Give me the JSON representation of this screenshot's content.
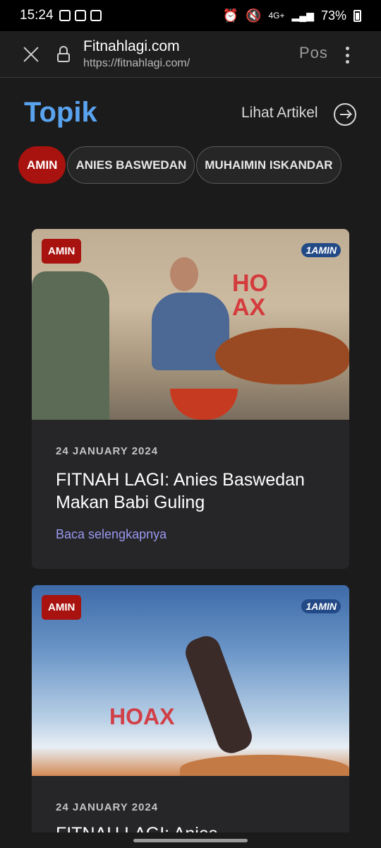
{
  "status_bar": {
    "time": "15:24",
    "network": "4G+",
    "battery": "73%"
  },
  "browser": {
    "site_title": "Fitnahlagi.com",
    "url": "https://fitnahlagi.com/",
    "partial_text": "Pos"
  },
  "topik": {
    "title": "Topik",
    "see_articles": "Lihat Artikel"
  },
  "tags": [
    {
      "label": "AMIN",
      "active": true
    },
    {
      "label": "ANIES BASWEDAN",
      "active": false
    },
    {
      "label": "MUHAIMIN ISKANDAR",
      "active": false
    }
  ],
  "articles": [
    {
      "badge": "AMIN",
      "logo": "1AMIN",
      "watermark": "HOAX",
      "date": "24 JANUARY 2024",
      "title": "FITNAH LAGI: Anies Baswedan Makan Babi Guling",
      "read_more": "Baca selengkapnya"
    },
    {
      "badge": "AMIN",
      "logo": "1AMIN",
      "watermark": "HOAX",
      "date": "24 JANUARY 2024",
      "title": "FITNAH LAGI: Anies"
    }
  ],
  "colors": {
    "accent_blue": "#5aa3ef",
    "tag_red": "#a8130f",
    "link_purple": "#9a98f0"
  }
}
